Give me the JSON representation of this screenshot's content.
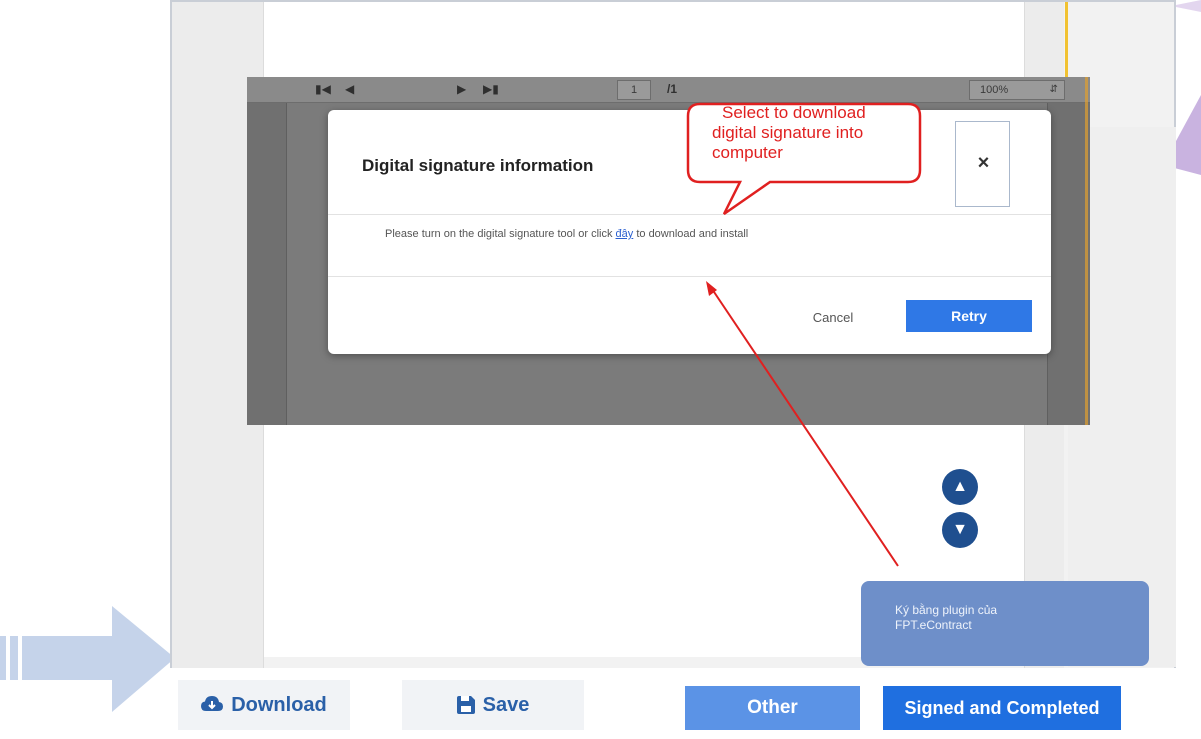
{
  "pdf_toolbar": {
    "first_icon": "first-page-icon",
    "prev_icon": "prev-page-icon",
    "page_number": "1",
    "page_total": "/1",
    "next_icon": "next-page-icon",
    "last_icon": "last-page-icon",
    "zoom": "100%"
  },
  "modal": {
    "title": "Digital signature information",
    "close_label": "×",
    "body_before": "Please turn on the digital signature tool or click ",
    "body_link": "đây",
    "body_after": " to download and install",
    "cancel_label": "Cancel",
    "retry_label": "Retry"
  },
  "callout": {
    "line1": "Select to download",
    "line2": "digital signature into",
    "line3": "computer",
    "color": "#e02020"
  },
  "tooltip": {
    "line1": "Ký bằng plugin của",
    "line2": "FPT.eContract"
  },
  "bottom_bar": {
    "download_label": "Download",
    "save_label": "Save",
    "other_label": "Other",
    "signed_label": "Signed and Completed"
  },
  "colors": {
    "primary": "#1f6fe0",
    "primary_light": "#5b93e6",
    "tooltip_bg": "#6e8fc9",
    "scroll_btn": "#1f4f8f",
    "callout": "#e02020"
  }
}
